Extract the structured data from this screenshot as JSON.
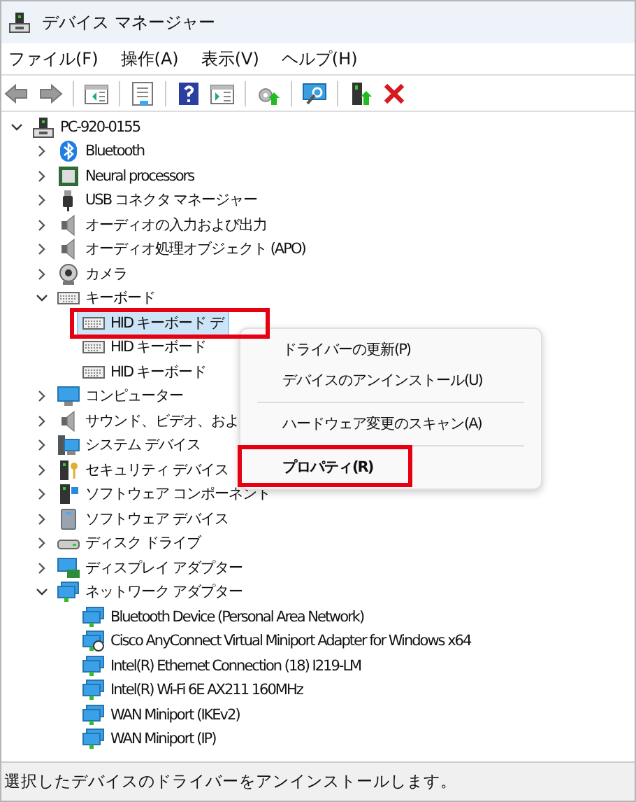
{
  "window": {
    "title": "デバイス マネージャー"
  },
  "menu_bar": [
    "ファイル(F)",
    "操作(A)",
    "表示(V)",
    "ヘルプ(H)"
  ],
  "toolbar": [
    {
      "kind": "back"
    },
    {
      "kind": "forward"
    },
    {
      "kind": "separator"
    },
    {
      "kind": "tree-toggle"
    },
    {
      "kind": "separator"
    },
    {
      "kind": "properties"
    },
    {
      "kind": "separator"
    },
    {
      "kind": "help"
    },
    {
      "kind": "action-pane"
    },
    {
      "kind": "separator"
    },
    {
      "kind": "update-driver"
    },
    {
      "kind": "separator"
    },
    {
      "kind": "scan"
    },
    {
      "kind": "separator"
    },
    {
      "kind": "enable"
    },
    {
      "kind": "uninstall"
    }
  ],
  "tree": {
    "label": "PC-920-0155",
    "kind": "computer",
    "expanded": true,
    "children": [
      {
        "label": "Bluetooth",
        "kind": "bluetooth",
        "expanded": false
      },
      {
        "label": "Neural processors",
        "kind": "chip",
        "expanded": false
      },
      {
        "label": "USB コネクタ マネージャー",
        "kind": "usb",
        "expanded": false
      },
      {
        "label": "オーディオの入力および出力",
        "kind": "speaker",
        "expanded": false
      },
      {
        "label": "オーディオ処理オブジェクト (APO)",
        "kind": "speaker",
        "expanded": false
      },
      {
        "label": "カメラ",
        "kind": "camera",
        "expanded": false
      },
      {
        "label": "キーボード",
        "kind": "keyboard",
        "expanded": true,
        "children": [
          {
            "label": "HID キーボード デ",
            "kind": "keyboard",
            "selected": true
          },
          {
            "label": "HID キーボード",
            "kind": "keyboard",
            "selected": false
          },
          {
            "label": "HID キーボード",
            "kind": "keyboard",
            "selected": false
          }
        ]
      },
      {
        "label": "コンピューター",
        "kind": "monitor",
        "expanded": false
      },
      {
        "label": "サウンド、ビデオ、およ",
        "kind": "speaker",
        "expanded": false
      },
      {
        "label": "システム デバイス",
        "kind": "system",
        "expanded": false
      },
      {
        "label": "セキュリティ デバイス",
        "kind": "security",
        "expanded": false
      },
      {
        "label": "ソフトウェア コンポーネント",
        "kind": "software-component",
        "expanded": false
      },
      {
        "label": "ソフトウェア デバイス",
        "kind": "software-device",
        "expanded": false
      },
      {
        "label": "ディスク ドライブ",
        "kind": "disk",
        "expanded": false
      },
      {
        "label": "ディスプレイ アダプター",
        "kind": "display-adapter",
        "expanded": false
      },
      {
        "label": "ネットワーク アダプター",
        "kind": "network",
        "expanded": true,
        "children": [
          {
            "label": "Bluetooth Device (Personal Area Network)",
            "kind": "network",
            "selected": false
          },
          {
            "label": "Cisco AnyConnect Virtual Miniport Adapter for Windows x64",
            "kind": "network-vpn",
            "selected": false
          },
          {
            "label": "Intel(R) Ethernet Connection (18) I219-LM",
            "kind": "network",
            "selected": false
          },
          {
            "label": "Intel(R) Wi-Fi 6E AX211 160MHz",
            "kind": "network",
            "selected": false
          },
          {
            "label": "WAN Miniport (IKEv2)",
            "kind": "network",
            "selected": false
          },
          {
            "label": "WAN Miniport (IP)",
            "kind": "network",
            "selected": false
          }
        ]
      }
    ]
  },
  "context_menu": [
    {
      "kind": "item",
      "label": "ドライバーの更新(P)"
    },
    {
      "kind": "item",
      "label": "デバイスのアンインストール(U)"
    },
    {
      "kind": "separator"
    },
    {
      "kind": "item",
      "label": "ハードウェア変更のスキャン(A)"
    },
    {
      "kind": "separator"
    },
    {
      "kind": "default",
      "label": "プロパティ(R)"
    }
  ],
  "status_bar": "選択したデバイスのドライバーをアンインストールします。"
}
